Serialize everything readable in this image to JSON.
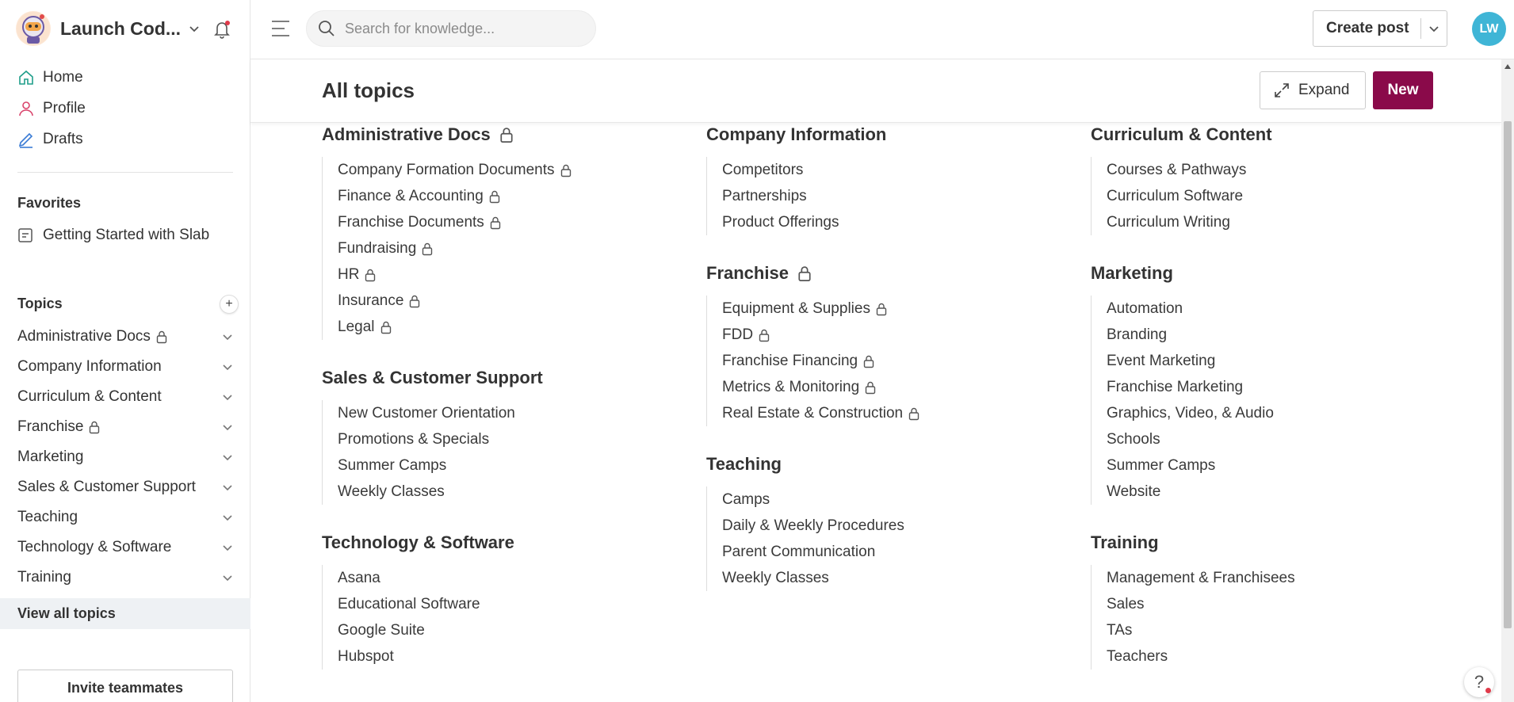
{
  "org": {
    "name": "Launch Cod..."
  },
  "nav": [
    {
      "label": "Home"
    },
    {
      "label": "Profile"
    },
    {
      "label": "Drafts"
    }
  ],
  "favorites": {
    "title": "Favorites",
    "items": [
      {
        "label": "Getting Started with Slab"
      }
    ]
  },
  "sidebar_topics": {
    "title": "Topics",
    "items": [
      {
        "label": "Administrative Docs",
        "locked": true
      },
      {
        "label": "Company Information",
        "locked": false
      },
      {
        "label": "Curriculum & Content",
        "locked": false
      },
      {
        "label": "Franchise",
        "locked": true
      },
      {
        "label": "Marketing",
        "locked": false
      },
      {
        "label": "Sales & Customer Support",
        "locked": false
      },
      {
        "label": "Teaching",
        "locked": false
      },
      {
        "label": "Technology & Software",
        "locked": false
      },
      {
        "label": "Training",
        "locked": false
      }
    ],
    "view_all": "View all topics"
  },
  "invite_label": "Invite teammates",
  "search": {
    "placeholder": "Search for knowledge..."
  },
  "create_post_label": "Create post",
  "avatar_initials": "LW",
  "page": {
    "title": "All topics",
    "expand_label": "Expand",
    "new_label": "New"
  },
  "columns": [
    [
      {
        "title": "Administrative Docs",
        "locked": true,
        "items": [
          {
            "label": "Company Formation Documents",
            "locked": true
          },
          {
            "label": "Finance & Accounting",
            "locked": true
          },
          {
            "label": "Franchise Documents",
            "locked": true
          },
          {
            "label": "Fundraising",
            "locked": true
          },
          {
            "label": "HR",
            "locked": true
          },
          {
            "label": "Insurance",
            "locked": true
          },
          {
            "label": "Legal",
            "locked": true
          }
        ]
      },
      {
        "title": "Sales & Customer Support",
        "locked": false,
        "items": [
          {
            "label": "New Customer Orientation",
            "locked": false
          },
          {
            "label": "Promotions & Specials",
            "locked": false
          },
          {
            "label": "Summer Camps",
            "locked": false
          },
          {
            "label": "Weekly Classes",
            "locked": false
          }
        ]
      },
      {
        "title": "Technology & Software",
        "locked": false,
        "items": [
          {
            "label": "Asana",
            "locked": false
          },
          {
            "label": "Educational Software",
            "locked": false
          },
          {
            "label": "Google Suite",
            "locked": false
          },
          {
            "label": "Hubspot",
            "locked": false
          }
        ]
      }
    ],
    [
      {
        "title": "Company Information",
        "locked": false,
        "items": [
          {
            "label": "Competitors",
            "locked": false
          },
          {
            "label": "Partnerships",
            "locked": false
          },
          {
            "label": "Product Offerings",
            "locked": false
          }
        ]
      },
      {
        "title": "Franchise",
        "locked": true,
        "items": [
          {
            "label": "Equipment & Supplies",
            "locked": true
          },
          {
            "label": "FDD",
            "locked": true
          },
          {
            "label": "Franchise Financing",
            "locked": true
          },
          {
            "label": "Metrics & Monitoring",
            "locked": true
          },
          {
            "label": "Real Estate & Construction",
            "locked": true
          }
        ]
      },
      {
        "title": "Teaching",
        "locked": false,
        "items": [
          {
            "label": "Camps",
            "locked": false
          },
          {
            "label": "Daily & Weekly Procedures",
            "locked": false
          },
          {
            "label": "Parent Communication",
            "locked": false
          },
          {
            "label": "Weekly Classes",
            "locked": false
          }
        ]
      }
    ],
    [
      {
        "title": "Curriculum & Content",
        "locked": false,
        "items": [
          {
            "label": "Courses & Pathways",
            "locked": false
          },
          {
            "label": "Curriculum Software",
            "locked": false
          },
          {
            "label": "Curriculum Writing",
            "locked": false
          }
        ]
      },
      {
        "title": "Marketing",
        "locked": false,
        "items": [
          {
            "label": "Automation",
            "locked": false
          },
          {
            "label": "Branding",
            "locked": false
          },
          {
            "label": "Event Marketing",
            "locked": false
          },
          {
            "label": "Franchise Marketing",
            "locked": false
          },
          {
            "label": "Graphics, Video, & Audio",
            "locked": false
          },
          {
            "label": "Schools",
            "locked": false
          },
          {
            "label": "Summer Camps",
            "locked": false
          },
          {
            "label": "Website",
            "locked": false
          }
        ]
      },
      {
        "title": "Training",
        "locked": false,
        "items": [
          {
            "label": "Management & Franchisees",
            "locked": false
          },
          {
            "label": "Sales",
            "locked": false
          },
          {
            "label": "TAs",
            "locked": false
          },
          {
            "label": "Teachers",
            "locked": false
          }
        ]
      }
    ]
  ],
  "help_label": "?",
  "colors": {
    "accent": "#8a0a4a",
    "avatar": "#3fb5d6",
    "nav_icon": "#1f9e8a",
    "profile_icon": "#d9436b",
    "drafts_icon": "#3a7bd5"
  }
}
